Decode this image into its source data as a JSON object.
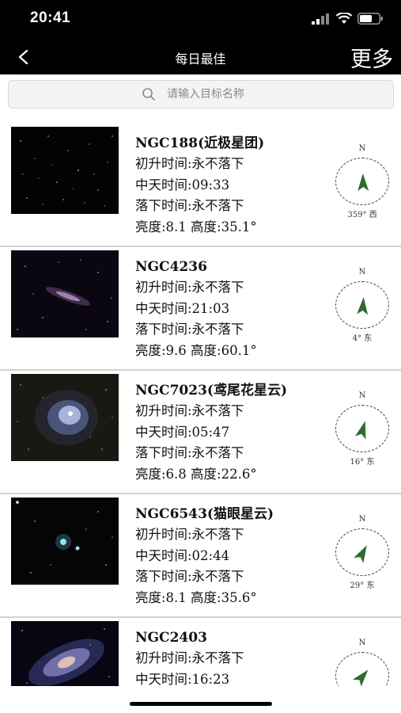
{
  "status": {
    "time": "20:41"
  },
  "nav": {
    "title": "每日最佳",
    "more": "更多"
  },
  "search": {
    "placeholder": "请输入目标名称"
  },
  "items": [
    {
      "name": "NGC188(近极星团)",
      "rise": "初升时间:永不落下",
      "transit": "中天时间:09:33",
      "set": "落下时间:永不落下",
      "stats": "亮度:8.1 高度:35.1°",
      "north": "N",
      "azimuth": "359° 西"
    },
    {
      "name": "NGC4236",
      "rise": "初升时间:永不落下",
      "transit": "中天时间:21:03",
      "set": "落下时间:永不落下",
      "stats": "亮度:9.6 高度:60.1°",
      "north": "N",
      "azimuth": "4° 东"
    },
    {
      "name": "NGC7023(鸢尾花星云)",
      "rise": "初升时间:永不落下",
      "transit": "中天时间:05:47",
      "set": "落下时间:永不落下",
      "stats": "亮度:6.8 高度:22.6°",
      "north": "N",
      "azimuth": "16° 东"
    },
    {
      "name": "NGC6543(猫眼星云)",
      "rise": "初升时间:永不落下",
      "transit": "中天时间:02:44",
      "set": "落下时间:永不落下",
      "stats": "亮度:8.1 高度:35.6°",
      "north": "N",
      "azimuth": "29° 东"
    },
    {
      "name": "NGC2403",
      "rise": "初升时间:永不落下",
      "transit": "中天时间:16:23",
      "set": "",
      "stats": "",
      "north": "N",
      "azimuth": ""
    }
  ]
}
